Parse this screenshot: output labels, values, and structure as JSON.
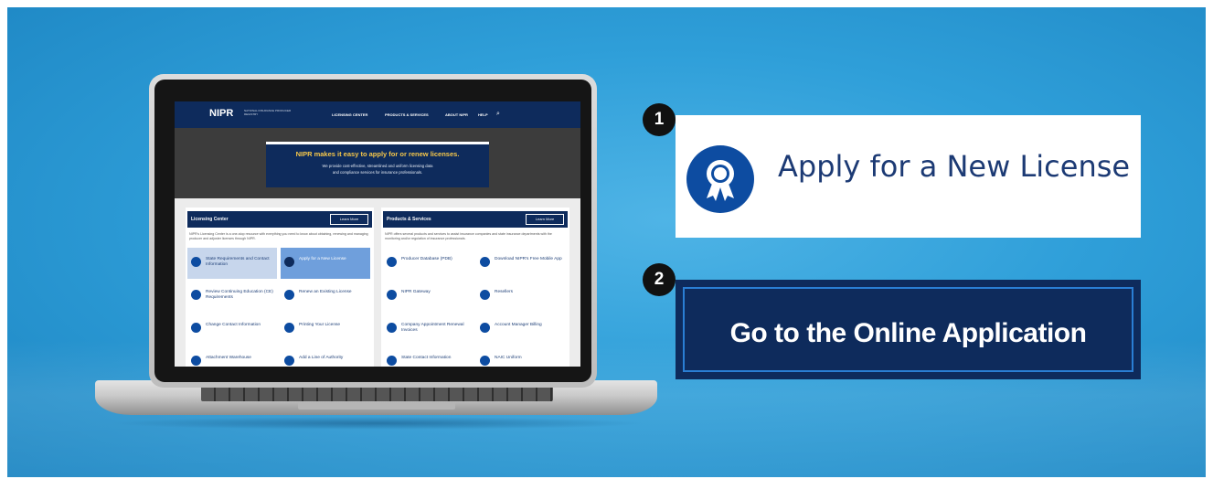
{
  "colors": {
    "background_blue": "#2f9fd9",
    "navy": "#0e2b5c",
    "brand_blue": "#0d4ca1",
    "hero_title_yellow": "#f7c84a",
    "badge_black": "#111111"
  },
  "steps": [
    {
      "number": "1",
      "label": "Apply for a New License",
      "icon": "award-ribbon-icon"
    },
    {
      "number": "2",
      "label": "Go to the Online Application"
    }
  ],
  "screen": {
    "logo": "NIPR",
    "logo_sub": "NATIONAL INSURANCE PRODUCER REGISTRY",
    "nav": [
      "LICENSING CENTER",
      "PRODUCTS & SERVICES",
      "ABOUT NIPR",
      "HELP"
    ],
    "hero_title": "NIPR makes it easy to apply for or renew licenses.",
    "hero_sub_1": "We provide cost-effective, streamlined and uniform licensing data",
    "hero_sub_2": "and compliance services for insurance professionals.",
    "learn_more": "Learn More",
    "licensing_panel": {
      "title": "Licensing Center",
      "desc": "NIPR's Licensing Center is a one-stop resource with everything you need to know about obtaining, renewing and managing producer and adjuster licenses through NIPR.",
      "items": [
        "State Requirements and Contact Information",
        "Apply for a New License",
        "Review Continuing Education (CE) Requirements",
        "Renew an Existing License",
        "Change Contact Information",
        "Printing Your License",
        "Attachment Warehouse",
        "Add a Line of Authority"
      ]
    },
    "products_panel": {
      "title": "Products & Services",
      "desc": "NIPR offers several products and services to assist insurance companies and state insurance departments with the monitoring and/or regulation of insurance professionals.",
      "items": [
        "Producer Database (PDB)",
        "Download NIPR's Free Mobile App",
        "NIPR Gateway",
        "Resellers",
        "Company Appointment Renewal Invoices",
        "Account Manager Billing",
        "State Contact Information",
        "NAIC Uniform"
      ]
    }
  }
}
